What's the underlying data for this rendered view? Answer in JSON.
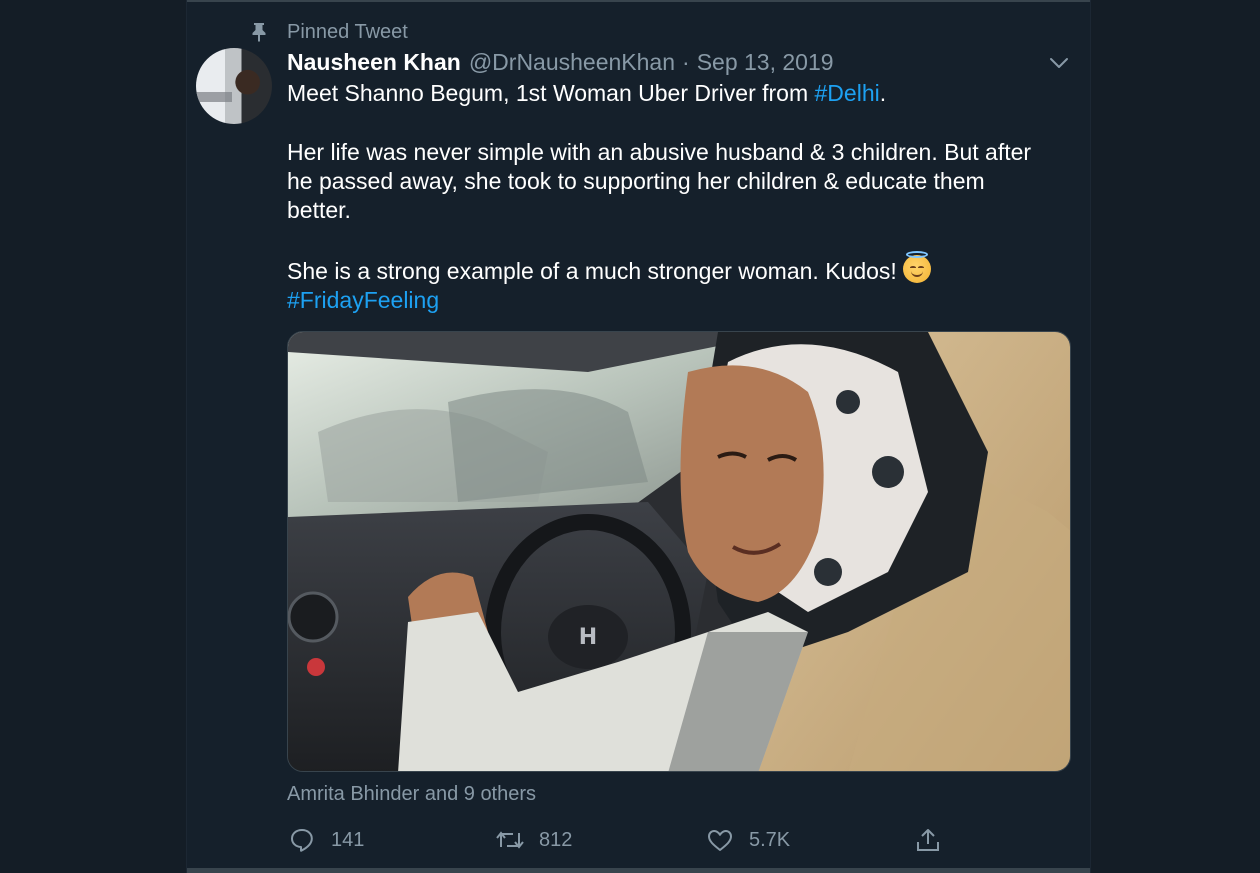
{
  "pinned_label": "Pinned Tweet",
  "author": {
    "display_name": "Nausheen Khan",
    "handle": "@DrNausheenKhan",
    "separator": "·",
    "date": "Sep 13, 2019"
  },
  "tweet": {
    "line1_text": "Meet Shanno Begum, 1st Woman Uber Driver from ",
    "line1_hashtag": "#Delhi",
    "line1_end": ".",
    "para2": [
      "Her life was never simple with an abusive husband & 3 children. But after",
      "he passed away, she took to supporting her children & educate them",
      "better."
    ],
    "para3_text": "She is a strong example of a much stronger woman. Kudos!",
    "para3_emoji": "smiling-face-with-halo",
    "hashtag2": "#FridayFeeling"
  },
  "likes_line": "Amrita Bhinder and 9 others",
  "actions": {
    "reply_count": "141",
    "retweet_count": "812",
    "like_count": "5.7K"
  },
  "icons": {
    "pin": "pin-icon",
    "caret": "chevron-down-icon",
    "reply": "reply-icon",
    "retweet": "retweet-icon",
    "like": "heart-icon",
    "share": "share-icon"
  },
  "colors": {
    "background": "#15202b",
    "secondary_text": "#8899a6",
    "link": "#1da1f2"
  }
}
